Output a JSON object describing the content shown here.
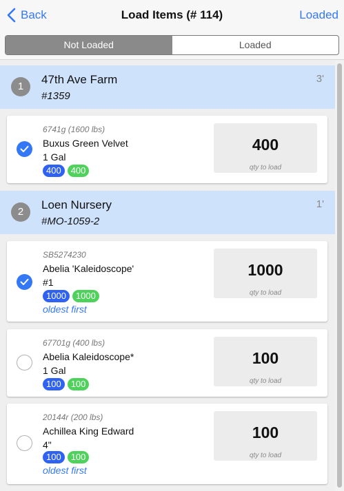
{
  "navbar": {
    "back_label": "Back",
    "title": "Load Items (# 114)",
    "right_label": "Loaded"
  },
  "segments": {
    "not_loaded": "Not Loaded",
    "loaded": "Loaded",
    "active": "Not Loaded"
  },
  "qty_label": "qty to load",
  "colors": {
    "accent": "#3478f6",
    "header_bg": "#cfe2fc",
    "badge_blue": "#2f62f0",
    "badge_green": "#4fd25b"
  },
  "groups": [
    {
      "number": "1",
      "name": "47th Ave Farm",
      "code": "#1359",
      "distance": "3'",
      "items": [
        {
          "sub": "6741g (1600 lbs)",
          "name": "Buxus Green Velvet",
          "size": "1 Gal",
          "badge_blue": "400",
          "badge_green": "400",
          "qty": "400",
          "checked": true
        }
      ]
    },
    {
      "number": "2",
      "name": "Loen Nursery",
      "code": "#MO-1059-2",
      "distance": "1'",
      "items": [
        {
          "sub": "SB5274230",
          "name": "Abelia 'Kaleidoscope'",
          "size": "#1",
          "badge_blue": "1000",
          "badge_green": "1000",
          "note": "oldest first",
          "qty": "1000",
          "checked": true
        },
        {
          "sub": "67701g (400 lbs)",
          "name": "Abelia Kaleidoscope*",
          "size": "1 Gal",
          "badge_blue": "100",
          "badge_green": "100",
          "qty": "100",
          "checked": false
        },
        {
          "sub": "20144r (200 lbs)",
          "name": "Achillea King Edward",
          "size": "4\"",
          "badge_blue": "100",
          "badge_green": "100",
          "note": "oldest first",
          "qty": "100",
          "checked": false
        }
      ]
    }
  ]
}
